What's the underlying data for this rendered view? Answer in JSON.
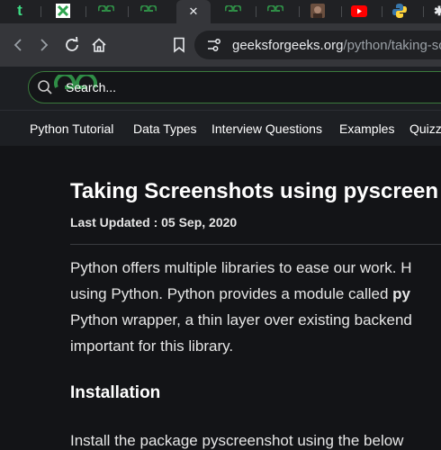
{
  "browser": {
    "tabs": [
      {
        "icon": "t-favicon",
        "glyph": "t",
        "color": "#3ddc84"
      },
      {
        "icon": "x-favicon",
        "glyph": "✕",
        "color": "#2ea44f"
      },
      {
        "icon": "gfg-favicon",
        "glyph": "GG",
        "color": "#2f8d46"
      },
      {
        "icon": "gfg-favicon",
        "glyph": "GG",
        "color": "#2f8d46"
      },
      {
        "icon": "close-icon",
        "glyph": "✕",
        "color": "#e8eaed"
      },
      {
        "icon": "gfg-favicon",
        "glyph": "GG",
        "color": "#2f8d46"
      },
      {
        "icon": "gfg-favicon",
        "glyph": "GG",
        "color": "#2f8d46"
      },
      {
        "icon": "avatar-favicon",
        "glyph": "",
        "color": "#8a6a55"
      },
      {
        "icon": "youtube-favicon",
        "glyph": "▶",
        "color": "#ff0000"
      },
      {
        "icon": "python-favicon",
        "glyph": "",
        "color": "#3776ab"
      },
      {
        "icon": "misc-favicon",
        "glyph": "✱",
        "color": "#e8eaed"
      }
    ],
    "url": {
      "domain": "geeksforgeeks.org",
      "path": "/python/taking-scr"
    }
  },
  "site": {
    "brand_color": "#2f8d46",
    "search_placeholder": "Search...",
    "nav": [
      "Python Tutorial",
      "Data Types",
      "Interview Questions",
      "Examples",
      "Quizzes"
    ]
  },
  "article": {
    "title": "Taking Screenshots using pyscreen",
    "updated": "Last Updated : 05 Sep, 2020",
    "paragraph": [
      "Python offers multiple libraries to ease our work. H",
      "using Python. Python provides a module called ",
      "Python wrapper, a thin layer over existing backend",
      "important for this library."
    ],
    "bold_fragment": "py",
    "heading": "Installation",
    "next_line": "Install the package pyscreenshot using the below"
  }
}
